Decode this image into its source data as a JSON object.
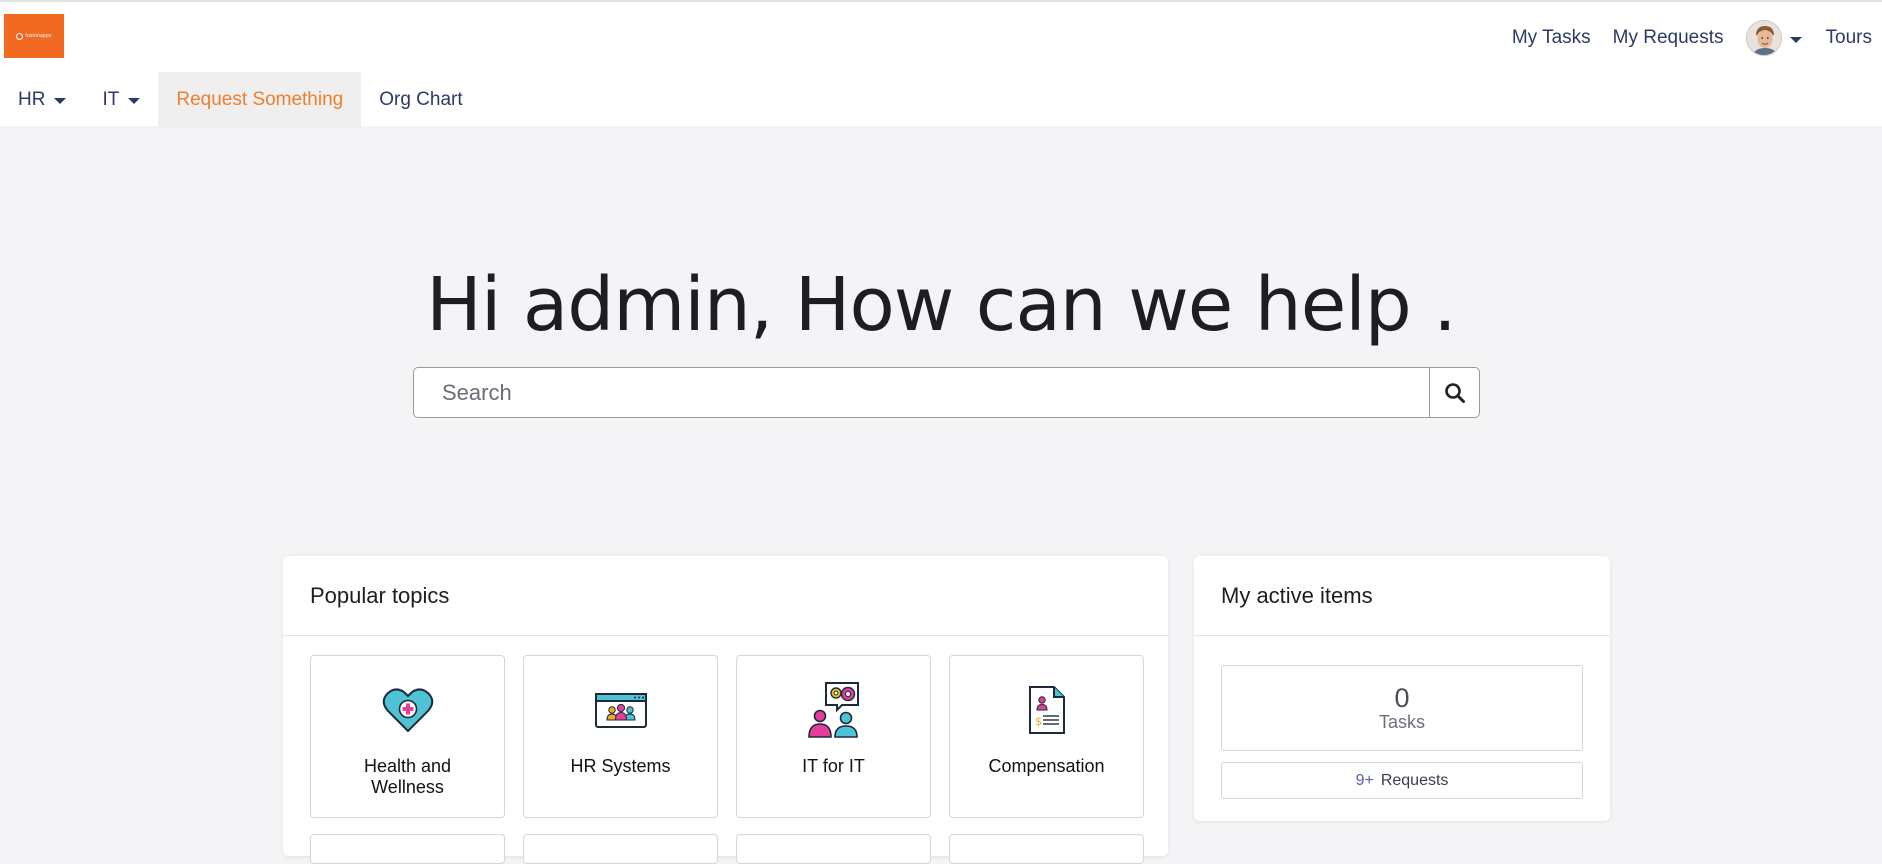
{
  "header": {
    "logo_text": "fusionapps",
    "links": {
      "my_tasks": "My Tasks",
      "my_requests": "My Requests",
      "tours": "Tours"
    }
  },
  "nav": {
    "hr": "HR",
    "it": "IT",
    "request_something": "Request Something",
    "org_chart": "Org Chart",
    "active_color": "#ee7f2d"
  },
  "hero": {
    "title": "Hi admin, How can we help .",
    "search_placeholder": "Search"
  },
  "popular_topics": {
    "title": "Popular topics",
    "tiles": [
      {
        "label": "Health and Wellness",
        "icon": "heart-plus-icon"
      },
      {
        "label": "HR Systems",
        "icon": "hr-systems-icon"
      },
      {
        "label": "IT for IT",
        "icon": "it-support-icon"
      },
      {
        "label": "Compensation",
        "icon": "compensation-document-icon"
      }
    ]
  },
  "active_items": {
    "title": "My active items",
    "tasks_count": "0",
    "tasks_label": "Tasks",
    "requests_count": "9+",
    "requests_label": "Requests"
  },
  "colors": {
    "brand_orange": "#f26a21",
    "nav_text": "#2b3a67",
    "page_bg": "#f4f4f6"
  }
}
